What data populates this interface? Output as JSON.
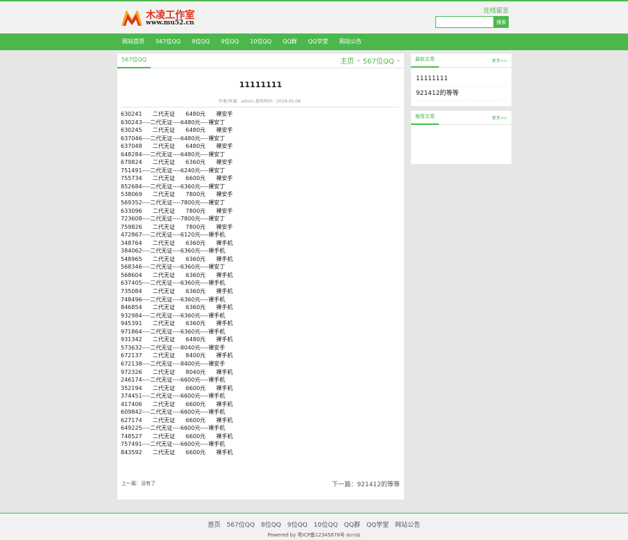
{
  "header": {
    "site_name": "木凌工作室",
    "site_url": "www.mu52.cn",
    "guestbook": "在线留言",
    "search_placeholder": "",
    "search_button": "搜索"
  },
  "nav": [
    "网站首页",
    "567位QQ",
    "8位QQ",
    "9位QQ",
    "10位QQ",
    "QQ群",
    "QQ学堂",
    "网站公告"
  ],
  "breadcrumb": {
    "tab": "567位QQ",
    "home": "主页",
    "sep": "»",
    "category": "567位QQ",
    "end": "»"
  },
  "article": {
    "title": "11111111",
    "meta": "作者/来源：admin    发布时间：2018-05-08",
    "lines": [
      "630241      二代无证      6480元      裸安手",
      "630243----二代无证----6480元----裸安丁",
      "630245      二代无证      6480元      裸安手",
      "637046----二代无证----6480元----裸安丁",
      "637048      二代无证      6480元      裸安手",
      "648284----二代无证----6480元----裸安丁",
      "679824      二代无证      6360元      裸安手",
      "751491----二代无证----6240元----裸安丁",
      "755734      二代无证      6600元      裸安手",
      "852684----二代无证----6360元----裸安丁",
      "538069      二代无证      7800元      裸安手",
      "569352----二代无证----7800元----裸安丁",
      "633096      二代无证      7800元      裸安手",
      "723608----二代无证----7800元----裸安丁",
      "759826      二代无证      7800元      裸安手",
      "472867----二代无证----6120元----裸手机",
      "348764      二代无证      6360元      裸手机",
      "384062----二代无证----6360元----裸手机",
      "548965      二代无证      6360元      裸手机",
      "568346----二代无证----6360元----裸安丁",
      "568604      二代无证      6360元      裸手机",
      "637405----二代无证----6360元----裸手机",
      "735084      二代无证      6360元      裸手机",
      "748496----二代无证----6360元----裸手机",
      "846854      二代无证      6360元      裸手机",
      "932984----二代无证----6360元----裸手机",
      "945391      二代无证      6360元      裸手机",
      "971864----二代无证----6360元----裸手机",
      "931342      二代无证      6480元      裸手机",
      "573632----二代无证----8040元----裸安手",
      "672137      二代无证      8400元      裸手机",
      "672138----二代无证----8400元----裸安手",
      "972326      二代无证      8040元      裸手机",
      "246174----二代无证----6600元----裸手机",
      "352194      二代无证      6600元      裸手机",
      "374451----二代无证----6600元----裸手机",
      "417406      二代无证      6600元      裸手机",
      "609842----二代无证----6600元----裸手机",
      "627174      二代无证      6600元      裸手机",
      "649225----二代无证----6600元----裸手机",
      "748527      二代无证      6600元      裸手机",
      "757491----二代无证----6600元----裸手机",
      "843592      二代无证      6600元      裸手机"
    ],
    "prev": "上一篇：没有了",
    "next": "下一篇：921412的等等"
  },
  "sidebar": {
    "latest_title": "最新文章",
    "latest_more": "更多>>",
    "latest_items": [
      "11111111",
      "921412的等等"
    ],
    "recommend_title": "推荐文章",
    "recommend_more": "更多>>"
  },
  "footer": {
    "links": [
      "首页",
      "567位QQ",
      "8位QQ",
      "9位QQ",
      "10位QQ",
      "QQ群",
      "QQ学堂",
      "网站公告"
    ],
    "powered": "Powered by",
    "icp": "粤ICP备12345678号",
    "stats": "统计代码"
  },
  "colors": {
    "accent": "#4cb84c",
    "logo_red": "#dd3322"
  }
}
